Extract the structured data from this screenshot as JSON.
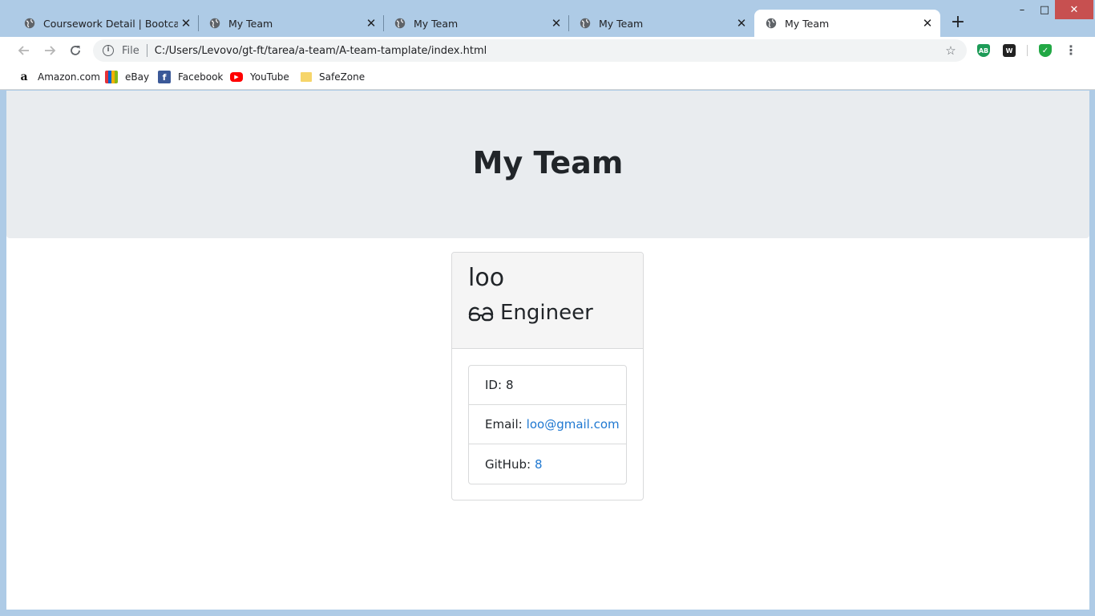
{
  "browser": {
    "tabs": [
      {
        "title": "Coursework Detail | Bootcamp S",
        "active": false
      },
      {
        "title": "My Team",
        "active": false
      },
      {
        "title": "My Team",
        "active": false
      },
      {
        "title": "My Team",
        "active": false
      },
      {
        "title": "My Team",
        "active": true
      }
    ],
    "new_tab_label": "+",
    "window_controls": {
      "minimize": "–",
      "maximize": "□",
      "close": "✕"
    },
    "address_bar": {
      "scheme_label": "File",
      "url": "C:/Users/Levovo/gt-ft/tarea/a-team/A-team-tamplate/index.html"
    },
    "extensions": [
      {
        "name": "adblock-extension-icon",
        "label": "AB"
      },
      {
        "name": "w-extension-icon",
        "label": "W"
      },
      {
        "name": "shield-extension-icon",
        "label": "✓"
      }
    ],
    "bookmarks": [
      {
        "label": "Amazon.com",
        "icon": "amazon-icon"
      },
      {
        "label": "eBay",
        "icon": "ebay-icon"
      },
      {
        "label": "Facebook",
        "icon": "facebook-icon"
      },
      {
        "label": "YouTube",
        "icon": "youtube-icon"
      },
      {
        "label": "SafeZone",
        "icon": "folder-icon"
      }
    ]
  },
  "page": {
    "header_title": "My Team",
    "employee": {
      "name": "loo",
      "role": "Engineer",
      "role_icon": "glasses-icon",
      "id_label": "ID:",
      "id_value": "8",
      "email_label": "Email:",
      "email_value": "loo@gmail.com",
      "github_label": "GitHub:",
      "github_value": "8"
    }
  },
  "colors": {
    "tabstrip": "#aecbe6",
    "jumbotron": "#e9ecef",
    "link": "#1f78d1",
    "card_header": "#f5f5f5"
  }
}
